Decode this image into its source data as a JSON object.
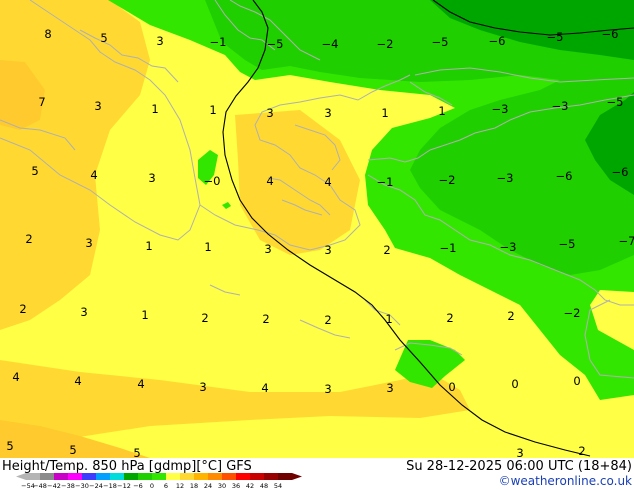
{
  "map": {
    "title": "Height/Temp. 850 hPa [gdmp][°C] GFS",
    "valid_time": "Su 28-12-2025 06:00 UTC (18+84)",
    "credit": "©weatheronline.co.uk",
    "colors": {
      "light_yellow": "#ffff45",
      "gold": "#ffd932",
      "dark_gold": "#ffca2e",
      "light_green": "#33e600",
      "mid_green": "#1fcf00",
      "dark_green": "#00a600",
      "coast": "#b0b0b0",
      "height_contour": "#000000"
    },
    "temp_labels": [
      {
        "text": "8"
      },
      {
        "text": "5"
      },
      {
        "text": "3"
      },
      {
        "text": "−1"
      },
      {
        "text": "−5"
      },
      {
        "text": "−4"
      },
      {
        "text": "−2"
      },
      {
        "text": "−5"
      },
      {
        "text": "−6"
      },
      {
        "text": "−5"
      },
      {
        "text": "−6"
      },
      {
        "text": "7"
      },
      {
        "text": "3"
      },
      {
        "text": "1"
      },
      {
        "text": "1"
      },
      {
        "text": "3"
      },
      {
        "text": "3"
      },
      {
        "text": "1"
      },
      {
        "text": "1"
      },
      {
        "text": "−3"
      },
      {
        "text": "−3"
      },
      {
        "text": "−5"
      },
      {
        "text": "5"
      },
      {
        "text": "4"
      },
      {
        "text": "3"
      },
      {
        "text": "−0"
      },
      {
        "text": "4"
      },
      {
        "text": "4"
      },
      {
        "text": "−1"
      },
      {
        "text": "−2"
      },
      {
        "text": "−3"
      },
      {
        "text": "−6"
      },
      {
        "text": "−6"
      },
      {
        "text": "2"
      },
      {
        "text": "3"
      },
      {
        "text": "1"
      },
      {
        "text": "1"
      },
      {
        "text": "3"
      },
      {
        "text": "3"
      },
      {
        "text": "2"
      },
      {
        "text": "−1"
      },
      {
        "text": "−3"
      },
      {
        "text": "−5"
      },
      {
        "text": "−7"
      },
      {
        "text": "2"
      },
      {
        "text": "3"
      },
      {
        "text": "1"
      },
      {
        "text": "2"
      },
      {
        "text": "2"
      },
      {
        "text": "2"
      },
      {
        "text": "1"
      },
      {
        "text": "2"
      },
      {
        "text": "2"
      },
      {
        "text": "−2"
      },
      {
        "text": "4"
      },
      {
        "text": "4"
      },
      {
        "text": "4"
      },
      {
        "text": "3"
      },
      {
        "text": "4"
      },
      {
        "text": "3"
      },
      {
        "text": "3"
      },
      {
        "text": "0"
      },
      {
        "text": "0"
      },
      {
        "text": "0"
      },
      {
        "text": "5"
      },
      {
        "text": "5"
      },
      {
        "text": "5"
      },
      {
        "text": "3"
      },
      {
        "text": "2"
      }
    ],
    "scale": {
      "labels": [
        "−54",
        "−48",
        "−42",
        "−38",
        "−30",
        "−24",
        "−18",
        "−12",
        "−6",
        "0",
        "6",
        "12",
        "18",
        "24",
        "30",
        "36",
        "42",
        "48",
        "54"
      ],
      "colors": [
        "#b4b4b4",
        "#8c8c8c",
        "#c800c8",
        "#ff00ff",
        "#3c3cff",
        "#00a0ff",
        "#00dcdc",
        "#00a600",
        "#1fcf00",
        "#33e600",
        "#ffff45",
        "#ffd932",
        "#ffb400",
        "#ff8c00",
        "#ff5000",
        "#ff0000",
        "#c80000",
        "#960000",
        "#6e0000"
      ]
    }
  }
}
